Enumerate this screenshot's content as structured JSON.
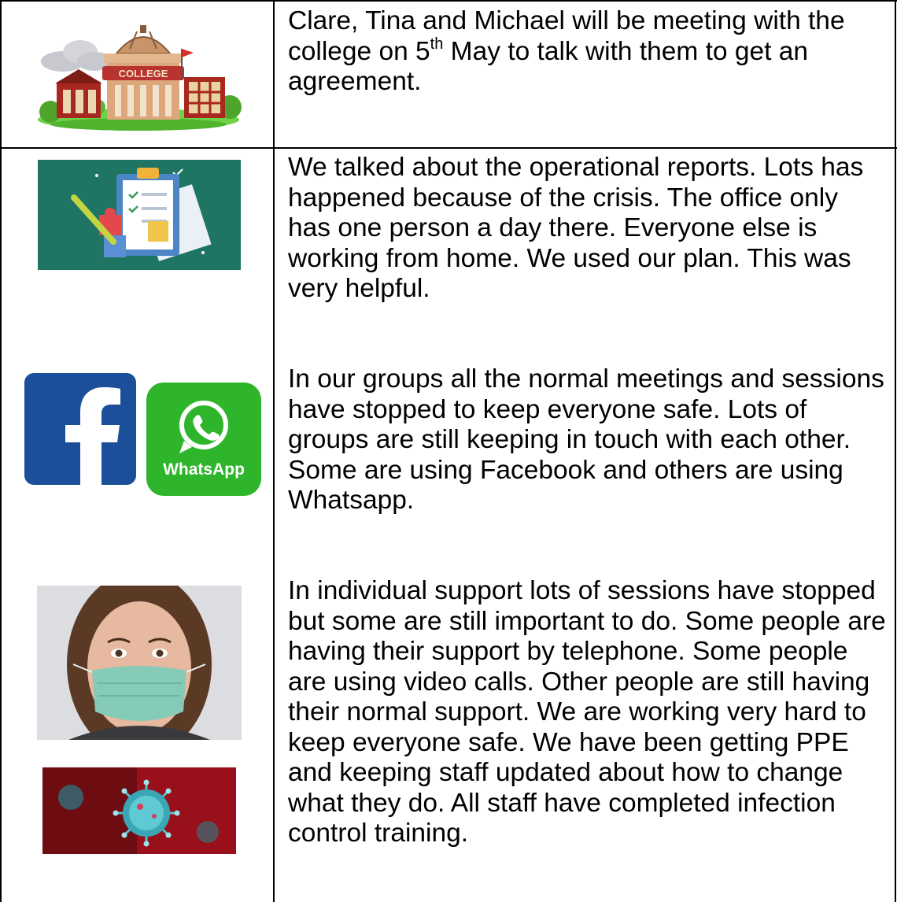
{
  "row1": {
    "image_label": "COLLEGE",
    "text_before_sup": "Clare, Tina and Michael will be meeting with the college on 5",
    "sup": "th",
    "text_after_sup": " May to talk with them to get an agreement."
  },
  "row2": {
    "paragraph_reports": "We talked about the operational reports. Lots has happened because of the crisis. The office only has one person a day there. Everyone else is working from home. We used our plan. This was very helpful.",
    "paragraph_groups": "In our groups all the normal meetings and sessions have stopped to keep everyone safe. Lots of groups are still keeping in touch with each other. Some are using Facebook and others are using Whatsapp.",
    "paragraph_support": "In individual support lots of sessions have stopped but some are still important to do. Some people are having their support by telephone. Some people are using video calls. Other people are still having their normal support. We are working very hard to keep everyone safe. We have been getting PPE and keeping staff updated about how to change what they do. All staff have completed infection control training.",
    "whatsapp_label": "WhatsApp"
  },
  "colors": {
    "border": "#000000",
    "college_roof": "#c8956b",
    "college_banner": "#b8322f",
    "building_red": "#a8281f",
    "grass": "#6fd34a",
    "clipboard_bg": "#1e7563",
    "facebook_blue": "#1c4f9a",
    "whatsapp_green": "#2fb52c",
    "mask_green": "#86cbb8",
    "virus_red": "#a3121b",
    "virus_cyan": "#4fc3cf"
  },
  "icons": [
    "college-illustration",
    "clipboard-reports-icon",
    "facebook-logo-icon",
    "whatsapp-logo-icon",
    "woman-mask-photo",
    "virus-image"
  ]
}
